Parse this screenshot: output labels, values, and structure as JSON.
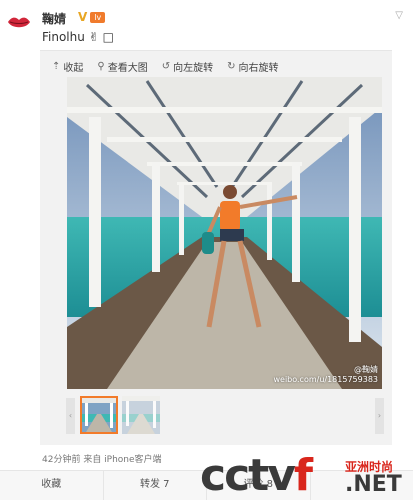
{
  "post": {
    "user_name": "鞠婧",
    "verified_badge": "V",
    "level_badge": "lv",
    "text": "Finolhu",
    "text_emoji": "✌",
    "text_extra": "□"
  },
  "toolbar": {
    "collapse_label": "收起",
    "view_large_label": "查看大图",
    "rotate_left_label": "向左旋转",
    "rotate_right_label": "向右旋转"
  },
  "photo": {
    "watermark_line1": "@鞠婧",
    "watermark_line2": "weibo.com/u/1815759383"
  },
  "meta": {
    "time_source": "42分钟前 来自 iPhone客户端"
  },
  "actions": {
    "favorite": "收藏",
    "repost": "转发 7",
    "comment": "评论 8",
    "like": ""
  },
  "logo": {
    "brand_prefix": "cctv",
    "brand_f": "f",
    "sub_text": "亚洲时尚",
    "net_text": ".NET"
  },
  "colors": {
    "accent": "#f27b2a",
    "brand_red": "#d9261c"
  }
}
